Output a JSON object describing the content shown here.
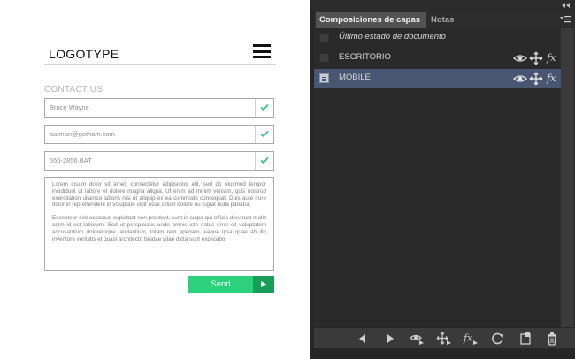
{
  "mockup": {
    "logo": "LOGOTYPE",
    "contact_label": "CONTACT US",
    "name_value": "Bruce Wayne",
    "email_value": "batman@gotham.com",
    "phone_value": "555-2856 BAT",
    "message_p1": "Lorem ipsum dolor sit amet, consectetur adipisicing elit, sed do eiusmod tempor incididunt ut labore et dolore magna aliqua. Ut enim ad minim veniam, quis nostrud exercitation ullamco laboris nisi ut aliquip ex ea commodo consequat. Duis aute irure dolor in reprehenderit in voluptate velit esse cillum dolore eu fugiat nulla pariatur.",
    "message_p2": "Excepteur sint occaecat cupidatat non proident, sunt in culpa qui officia deserunt mollit anim id est laborum. Sed ut perspiciatis unde omnis iste natus error sit voluptatem accusantium doloremque laudantium, totam rem aperiam, eaque ipsa quae ab illo inventore veritatis et quasi architecto beatae vitae dicta sunt explicabo.",
    "send_label": "Send",
    "colors": {
      "accent": "#2cd07d",
      "accent_dark": "#199c58",
      "check": "#2cb87a"
    }
  },
  "panel": {
    "tabs": [
      "Composiciones de capas",
      "Notas"
    ],
    "rows": [
      {
        "name": "Último estado de documento",
        "selected": false
      },
      {
        "name": "ESCRITORIO",
        "selected": false
      },
      {
        "name": "MOBILE",
        "selected": true
      }
    ],
    "fx_label": "fx",
    "icons": {
      "row": [
        "eye-icon",
        "move-icon",
        "fx-icon"
      ],
      "toolbar": [
        "previous-icon",
        "next-icon",
        "apply-visibility-icon",
        "apply-position-icon",
        "apply-style-icon",
        "update-icon",
        "new-comp-icon",
        "trash-icon"
      ]
    },
    "colors": {
      "bg": "#323232",
      "list_bg": "#2a2a2a",
      "selection": "#485671"
    }
  }
}
